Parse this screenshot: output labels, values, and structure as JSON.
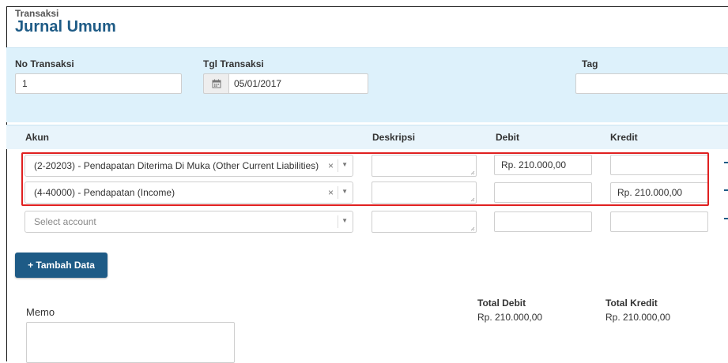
{
  "header": {
    "breadcrumb": "Transaksi",
    "title": "Jurnal Umum"
  },
  "form": {
    "no_transaksi_label": "No Transaksi",
    "no_transaksi_value": "1",
    "tgl_transaksi_label": "Tgl Transaksi",
    "tgl_transaksi_value": "05/01/2017",
    "tag_label": "Tag",
    "tag_value": ""
  },
  "table": {
    "columns": {
      "akun": "Akun",
      "deskripsi": "Deskripsi",
      "debit": "Debit",
      "kredit": "Kredit"
    },
    "rows": [
      {
        "akun": "(2-20203) - Pendapatan Diterima Di Muka (Other Current Liabilities)",
        "deskripsi": "",
        "debit": "Rp. 210.000,00",
        "kredit": ""
      },
      {
        "akun": "(4-40000) - Pendapatan (Income)",
        "deskripsi": "",
        "debit": "",
        "kredit": "Rp. 210.000,00"
      },
      {
        "akun_placeholder": "Select account",
        "deskripsi": "",
        "debit": "",
        "kredit": ""
      }
    ],
    "clear_symbol": "×",
    "arrow_symbol": "▼"
  },
  "add_button_label": "+ Tambah Data",
  "memo": {
    "label": "Memo",
    "value": ""
  },
  "totals": {
    "debit_label": "Total Debit",
    "debit_value": "Rp. 210.000,00",
    "kredit_label": "Total Kredit",
    "kredit_value": "Rp. 210.000,00"
  },
  "colors": {
    "brand": "#1e5b86",
    "panel": "#ddf1fb",
    "highlight": "#e02020"
  },
  "icons": {
    "date": "calendar-icon"
  }
}
